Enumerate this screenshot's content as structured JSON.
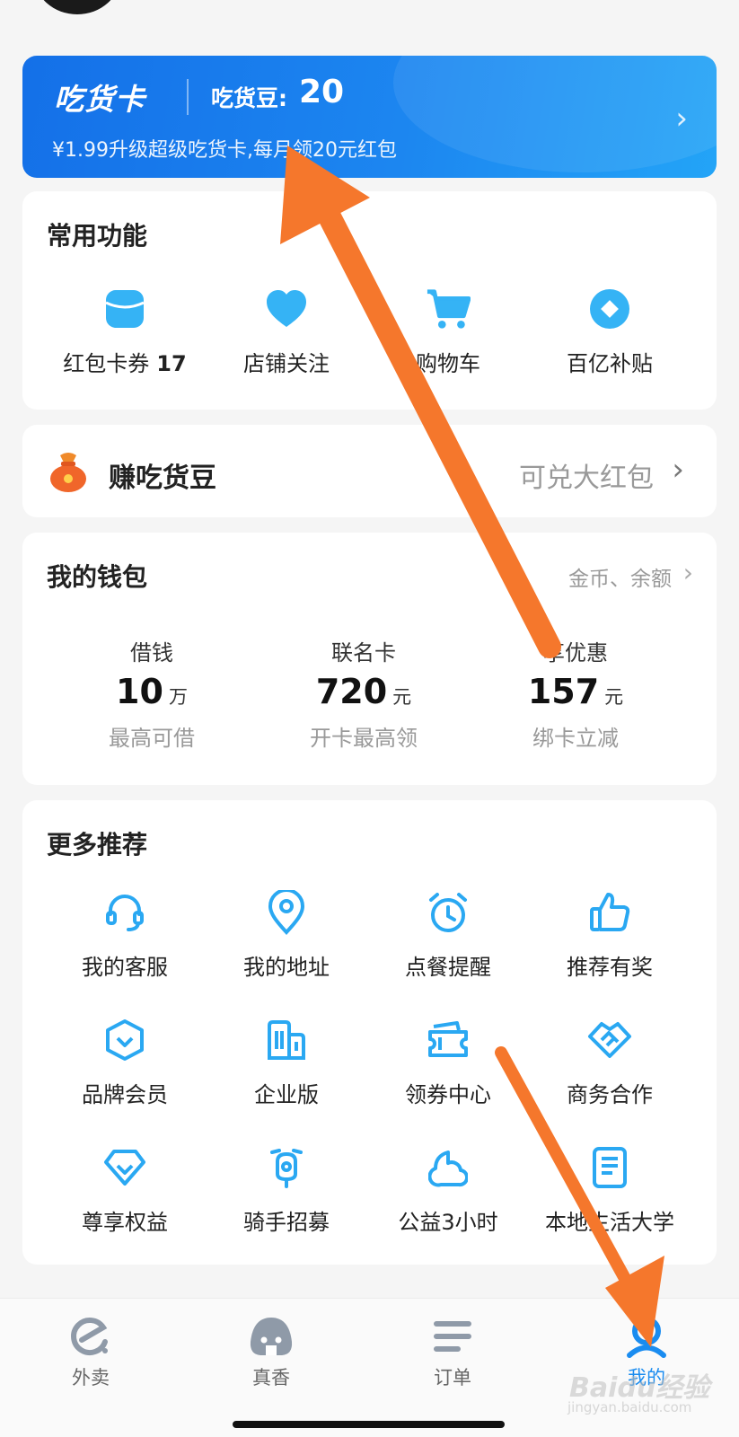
{
  "banner": {
    "title": "吃货卡",
    "beans_label": "吃货豆:",
    "beans_value": "20",
    "subtitle": "¥1.99升级超级吃货卡,每月领20元红包"
  },
  "common": {
    "title": "常用功能",
    "items": [
      {
        "label": "红包卡券",
        "count": "17",
        "icon": "coupon-icon"
      },
      {
        "label": "店铺关注",
        "count": "",
        "icon": "heart-icon"
      },
      {
        "label": "购物车",
        "count": "",
        "icon": "cart-icon"
      },
      {
        "label": "百亿补贴",
        "count": "",
        "icon": "subsidy-icon"
      }
    ]
  },
  "earn": {
    "title": "赚吃货豆",
    "hint": "可兑大红包"
  },
  "wallet": {
    "title": "我的钱包",
    "link": "金币、余额",
    "items": [
      {
        "label": "借钱",
        "value": "10",
        "unit": "万",
        "sub": "最高可借"
      },
      {
        "label": "联名卡",
        "value": "720",
        "unit": "元",
        "sub": "开卡最高领"
      },
      {
        "label": "享优惠",
        "value": "157",
        "unit": "元",
        "sub": "绑卡立减"
      }
    ]
  },
  "more": {
    "title": "更多推荐",
    "items": [
      {
        "label": "我的客服",
        "icon": "headset-icon"
      },
      {
        "label": "我的地址",
        "icon": "location-pin-icon"
      },
      {
        "label": "点餐提醒",
        "icon": "alarm-clock-icon"
      },
      {
        "label": "推荐有奖",
        "icon": "thumbs-up-icon"
      },
      {
        "label": "品牌会员",
        "icon": "brand-shield-icon"
      },
      {
        "label": "企业版",
        "icon": "building-icon"
      },
      {
        "label": "领券中心",
        "icon": "ticket-icon"
      },
      {
        "label": "商务合作",
        "icon": "handshake-icon"
      },
      {
        "label": "尊享权益",
        "icon": "diamond-icon"
      },
      {
        "label": "骑手招募",
        "icon": "scooter-icon"
      },
      {
        "label": "公益3小时",
        "icon": "cloud-heart-icon"
      },
      {
        "label": "本地生活大学",
        "icon": "document-icon"
      }
    ]
  },
  "tabbar": {
    "items": [
      {
        "label": "外卖",
        "icon": "eleme-icon",
        "active": false
      },
      {
        "label": "真香",
        "icon": "riceball-icon",
        "active": false
      },
      {
        "label": "订单",
        "icon": "list-icon",
        "active": false
      },
      {
        "label": "我的",
        "icon": "person-icon",
        "active": true
      }
    ]
  },
  "watermark": {
    "text": "Baidu经验",
    "sub": "jingyan.baidu.com"
  },
  "colors": {
    "accent": "#1a8cf0",
    "icon_blue": "#2aa8f2",
    "arrow_orange": "#f5772c"
  }
}
